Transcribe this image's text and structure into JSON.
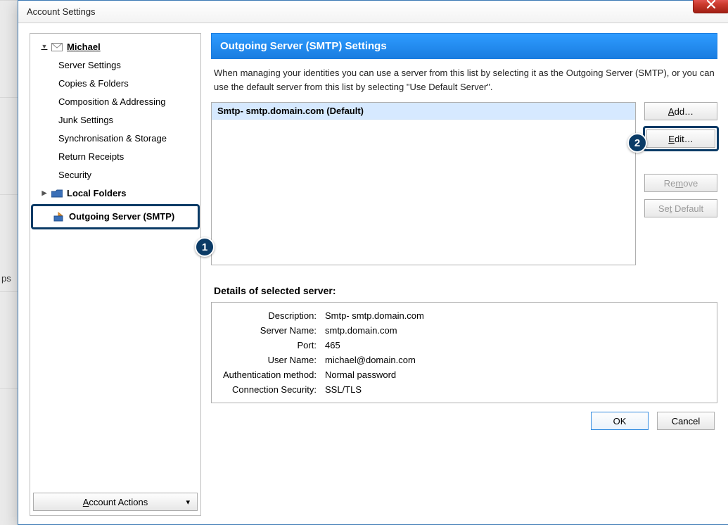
{
  "bg": {
    "ps": "ps"
  },
  "window": {
    "title": "Account Settings"
  },
  "sidebar": {
    "michael": "Michael",
    "items": [
      "Server Settings",
      "Copies & Folders",
      "Composition & Addressing",
      "Junk Settings",
      "Synchronisation & Storage",
      "Return Receipts",
      "Security"
    ],
    "localFolders": "Local Folders",
    "outgoingServer": "Outgoing Server (SMTP)",
    "accountActionsPrefix": "A",
    "accountActionsRest": "ccount Actions"
  },
  "badges": {
    "one": "1",
    "two": "2"
  },
  "panel": {
    "title": "Outgoing Server (SMTP) Settings",
    "desc": "When managing your identities you can use a server from this list by selecting it as the Outgoing Server (SMTP), or you can use the default server from this list by selecting \"Use Default Server\".",
    "selectedServer": "Smtp- smtp.domain.com (Default)"
  },
  "buttons": {
    "addPrefix": "A",
    "addRest": "dd…",
    "editPrefix": "E",
    "editRest": "dit…",
    "removePre": "Re",
    "removeU": "m",
    "removePost": "ove",
    "setPre": "Se",
    "setU": "t",
    "setPost": " Default",
    "ok": "OK",
    "cancel": "Cancel"
  },
  "details": {
    "title": "Details of selected server:",
    "labels": {
      "description": "Description:",
      "serverName": "Server Name:",
      "port": "Port:",
      "userName": "User Name:",
      "authMethod": "Authentication method:",
      "connSec": "Connection Security:"
    },
    "values": {
      "description": "Smtp- smtp.domain.com",
      "serverName": "smtp.domain.com",
      "port": "465",
      "userName": "michael@domain.com",
      "authMethod": "Normal password",
      "connSec": "SSL/TLS"
    }
  }
}
